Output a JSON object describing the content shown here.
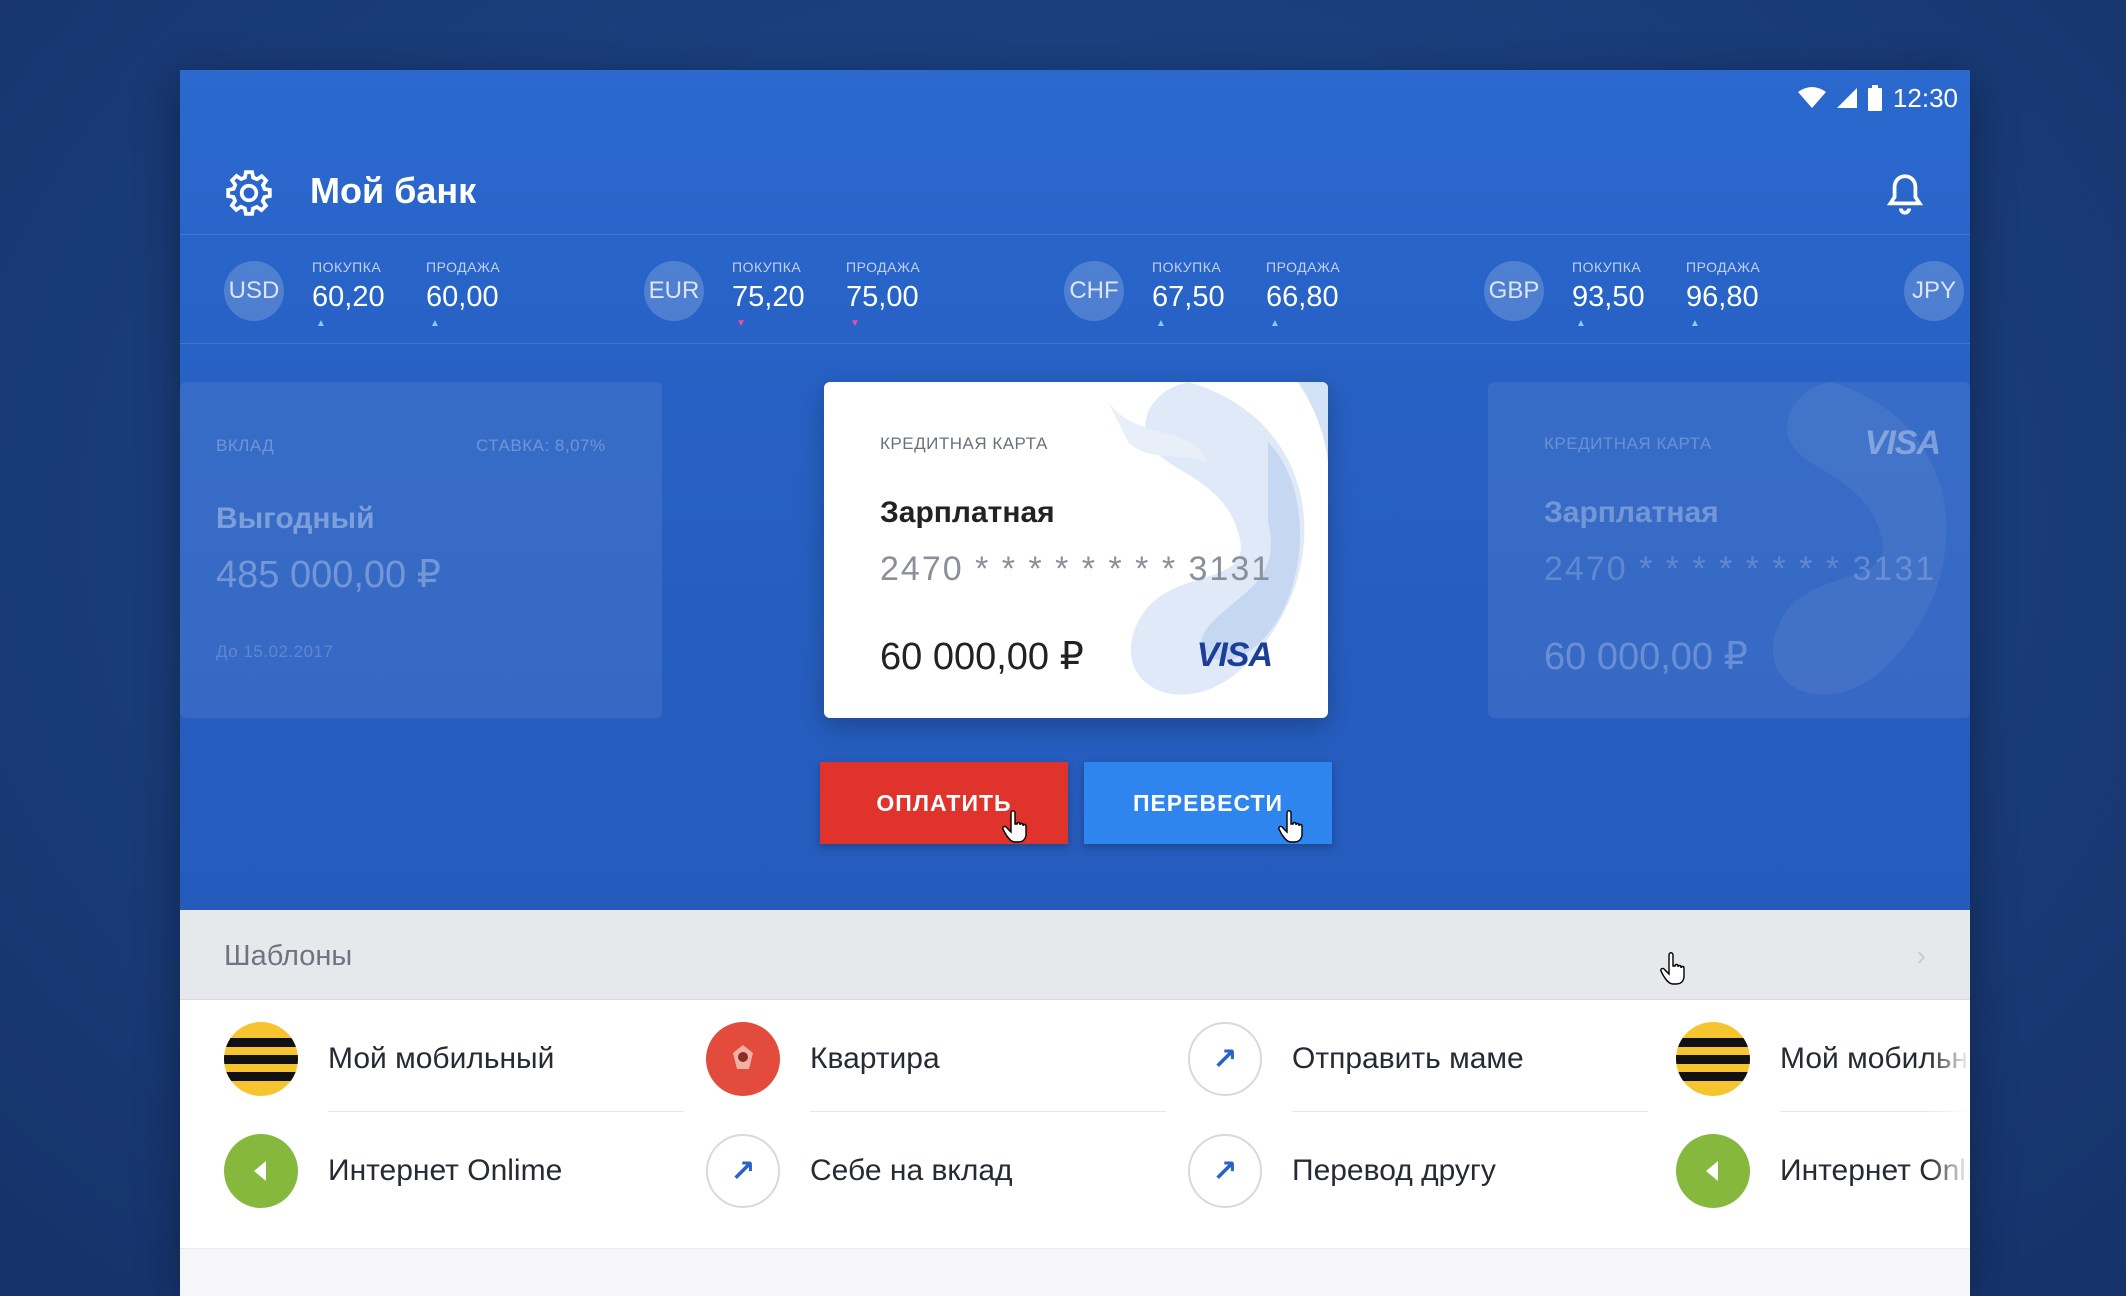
{
  "status": {
    "time": "12:30"
  },
  "app": {
    "title": "Мой банк"
  },
  "rates": [
    {
      "code": "USD",
      "buy_label": "ПОКУПКА",
      "buy": "60,20",
      "buy_trend": "up",
      "sell_label": "ПРОДАЖА",
      "sell": "60,00",
      "sell_trend": "up"
    },
    {
      "code": "EUR",
      "buy_label": "ПОКУПКА",
      "buy": "75,20",
      "buy_trend": "down",
      "sell_label": "ПРОДАЖА",
      "sell": "75,00",
      "sell_trend": "down"
    },
    {
      "code": "CHF",
      "buy_label": "ПОКУПКА",
      "buy": "67,50",
      "buy_trend": "up",
      "sell_label": "ПРОДАЖА",
      "sell": "66,80",
      "sell_trend": "up"
    },
    {
      "code": "GBP",
      "buy_label": "ПОКУПКА",
      "buy": "93,50",
      "buy_trend": "up",
      "sell_label": "ПРОДАЖА",
      "sell": "96,80",
      "sell_trend": "up"
    },
    {
      "code": "JPY"
    }
  ],
  "cards": {
    "left": {
      "type": "ВКЛАД",
      "rate": "СТАВКА: 8,07%",
      "name": "Выгодный",
      "amount": "485 000,00 ₽",
      "until": "До 15.02.2017"
    },
    "center": {
      "type": "КРЕДИТНАЯ КАРТА",
      "name": "Зарплатная",
      "number": "2470  * * * *    * * * *  3131",
      "amount": "60 000,00 ₽",
      "brand": "VISA"
    },
    "right": {
      "type": "КРЕДИТНАЯ КАРТА",
      "name": "Зарплатная",
      "number": "2470  * * * *    * * * *  3131",
      "amount": "60 000,00 ₽",
      "brand": "VISA"
    }
  },
  "actions": {
    "pay": "ОПЛАТИТЬ",
    "transfer": "ПЕРЕВЕСТИ"
  },
  "templates": {
    "title": "Шаблоны",
    "items": [
      {
        "label": "Мой мобильный",
        "icon": "beeline-icon"
      },
      {
        "label": "Квартира",
        "icon": "moscow-emblem-icon"
      },
      {
        "label": "Отправить маме",
        "icon": "arrow-up-right-icon"
      },
      {
        "label": "Мой мобильный",
        "icon": "beeline-icon"
      },
      {
        "label": "Интернет Onlime",
        "icon": "onlime-icon"
      },
      {
        "label": "Себе на вклад",
        "icon": "arrow-up-right-icon"
      },
      {
        "label": "Перевод другу",
        "icon": "arrow-up-right-icon"
      },
      {
        "label": "Интернет Onlime",
        "icon": "onlime-icon"
      }
    ]
  },
  "colors": {
    "primary": "#2a63c6",
    "pay": "#e0332b",
    "transfer": "#2f85ee",
    "background": "#1b3f7e"
  }
}
